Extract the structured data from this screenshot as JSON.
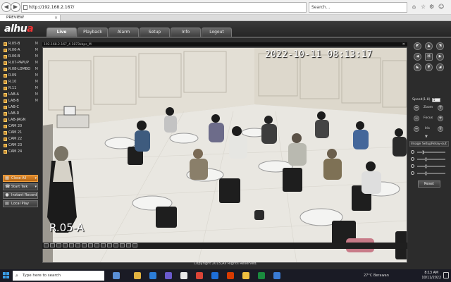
{
  "browser": {
    "url": "http://192.168.2.167/",
    "search_placeholder": "Search...",
    "tab_title": "PREVIEW"
  },
  "app": {
    "logo_main": "alhu",
    "logo_accent": "a",
    "nav": [
      "Live",
      "Playback",
      "Alarm",
      "Setup",
      "Info",
      "Logout"
    ],
    "active_nav": "Live",
    "copyright": "Copyright 2015,All Rights Reserved."
  },
  "channels": [
    {
      "label": "R.05-B",
      "mode": "M"
    },
    {
      "label": "R.06-A",
      "mode": "M"
    },
    {
      "label": "R.06-B",
      "mode": "M"
    },
    {
      "label": "R.07-PAPUP",
      "mode": "M"
    },
    {
      "label": "R.08-LOMBO",
      "mode": "M"
    },
    {
      "label": "R.09",
      "mode": "M"
    },
    {
      "label": "R.10",
      "mode": "M"
    },
    {
      "label": "R.11",
      "mode": "M"
    },
    {
      "label": "LAB-A",
      "mode": "M"
    },
    {
      "label": "LAB-B",
      "mode": "M"
    },
    {
      "label": "LAB-C",
      "mode": ""
    },
    {
      "label": "LAB-D",
      "mode": ""
    },
    {
      "label": "LAB-JRGN",
      "mode": ""
    },
    {
      "label": "CAM 20",
      "mode": ""
    },
    {
      "label": "CAM 21",
      "mode": ""
    },
    {
      "label": "CAM 22",
      "mode": ""
    },
    {
      "label": "CAM 23",
      "mode": ""
    },
    {
      "label": "CAM 24",
      "mode": ""
    }
  ],
  "controls": {
    "close_all": "Close All",
    "start_talk": "Start Talk",
    "instant_record": "Instant Record",
    "local_play": "Local Play"
  },
  "video": {
    "status_text": "192.168.2.167_4  1873kbps_M",
    "timestamp": "2022-10-11  08:13:17",
    "camera_name": "R.05-A"
  },
  "ptz": {
    "speed_label": "Speed(1-8)",
    "speed_value": "5",
    "zoom_label": "Zoom",
    "focus_label": "Focus",
    "iris_label": "Iris",
    "image_setup_label": "Image Setup",
    "relay_out_label": "Relay-out",
    "reset_label": "Reset",
    "sliders": [
      0.2,
      0.3,
      0.3,
      0.3
    ]
  },
  "taskbar": {
    "search_placeholder": "Type here to search",
    "weather": "27°C  Berawan",
    "time": "8:13 AM",
    "date": "10/11/2022"
  }
}
